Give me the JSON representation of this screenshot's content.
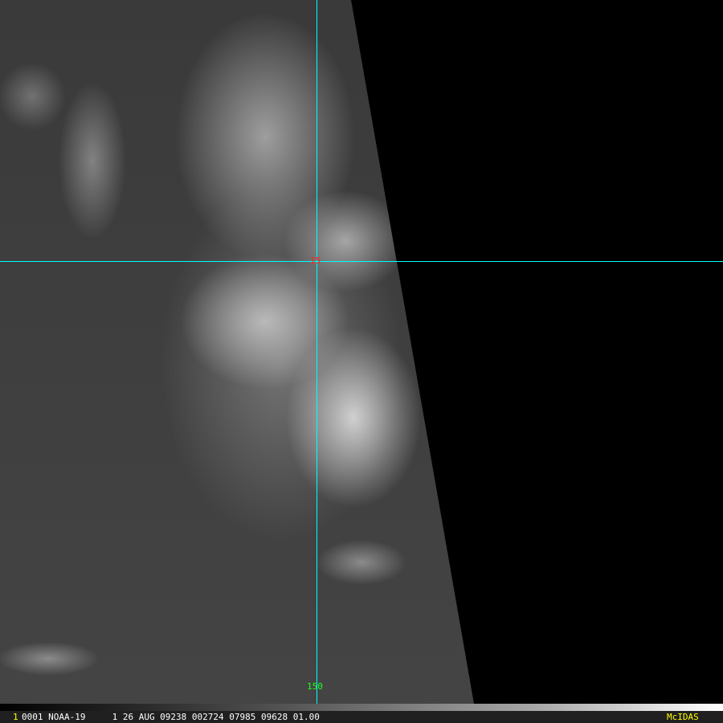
{
  "overlay": {
    "latitude_label": "15",
    "longitude_label": "150",
    "grid_color": "#00ffff"
  },
  "status_bar": {
    "frame_number": "1",
    "text": "0001 NOAA-19     1 26 AUG 09238 002724 07985 09628 01.00",
    "brand": "McIDAS"
  }
}
